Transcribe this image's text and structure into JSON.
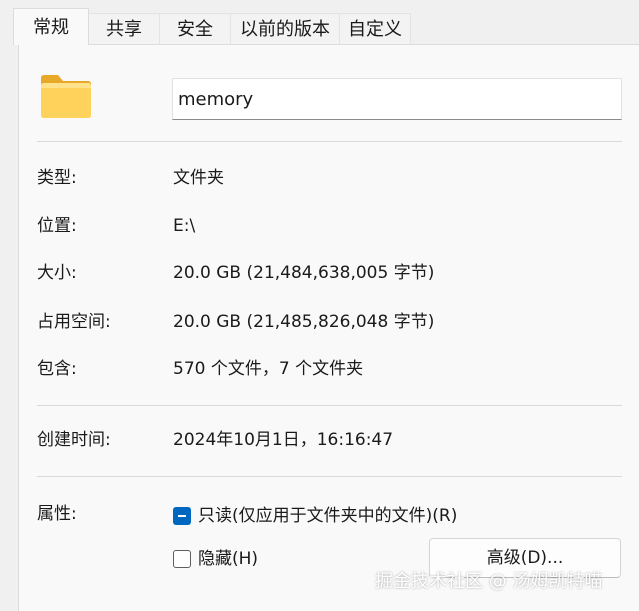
{
  "tabs": [
    {
      "label": "常规",
      "active": true
    },
    {
      "label": "共享",
      "active": false
    },
    {
      "label": "安全",
      "active": false
    },
    {
      "label": "以前的版本",
      "active": false
    },
    {
      "label": "自定义",
      "active": false
    }
  ],
  "folder": {
    "icon": "folder-icon",
    "name": "memory"
  },
  "properties": {
    "type": {
      "label": "类型:",
      "value": "文件夹"
    },
    "location": {
      "label": "位置:",
      "value": "E:\\"
    },
    "size": {
      "label": "大小:",
      "value": "20.0 GB (21,484,638,005 字节)"
    },
    "size_on_disk": {
      "label": "占用空间:",
      "value": "20.0 GB (21,485,826,048 字节)"
    },
    "contains": {
      "label": "包含:",
      "value": "570 个文件，7 个文件夹"
    },
    "created": {
      "label": "创建时间:",
      "value": "2024年10月1日，16:16:47"
    },
    "attributes": {
      "label": "属性:"
    }
  },
  "attributes": {
    "readonly": {
      "label": "只读(仅应用于文件夹中的文件)(R)",
      "state": "indeterminate"
    },
    "hidden": {
      "label": "隐藏(H)",
      "state": "unchecked"
    },
    "advanced_button": "高级(D)..."
  },
  "colors": {
    "accent": "#0067c0",
    "folder_yellow": "#ffd35b"
  },
  "watermark": "掘金技术社区 @ 汤姆凯特喵"
}
